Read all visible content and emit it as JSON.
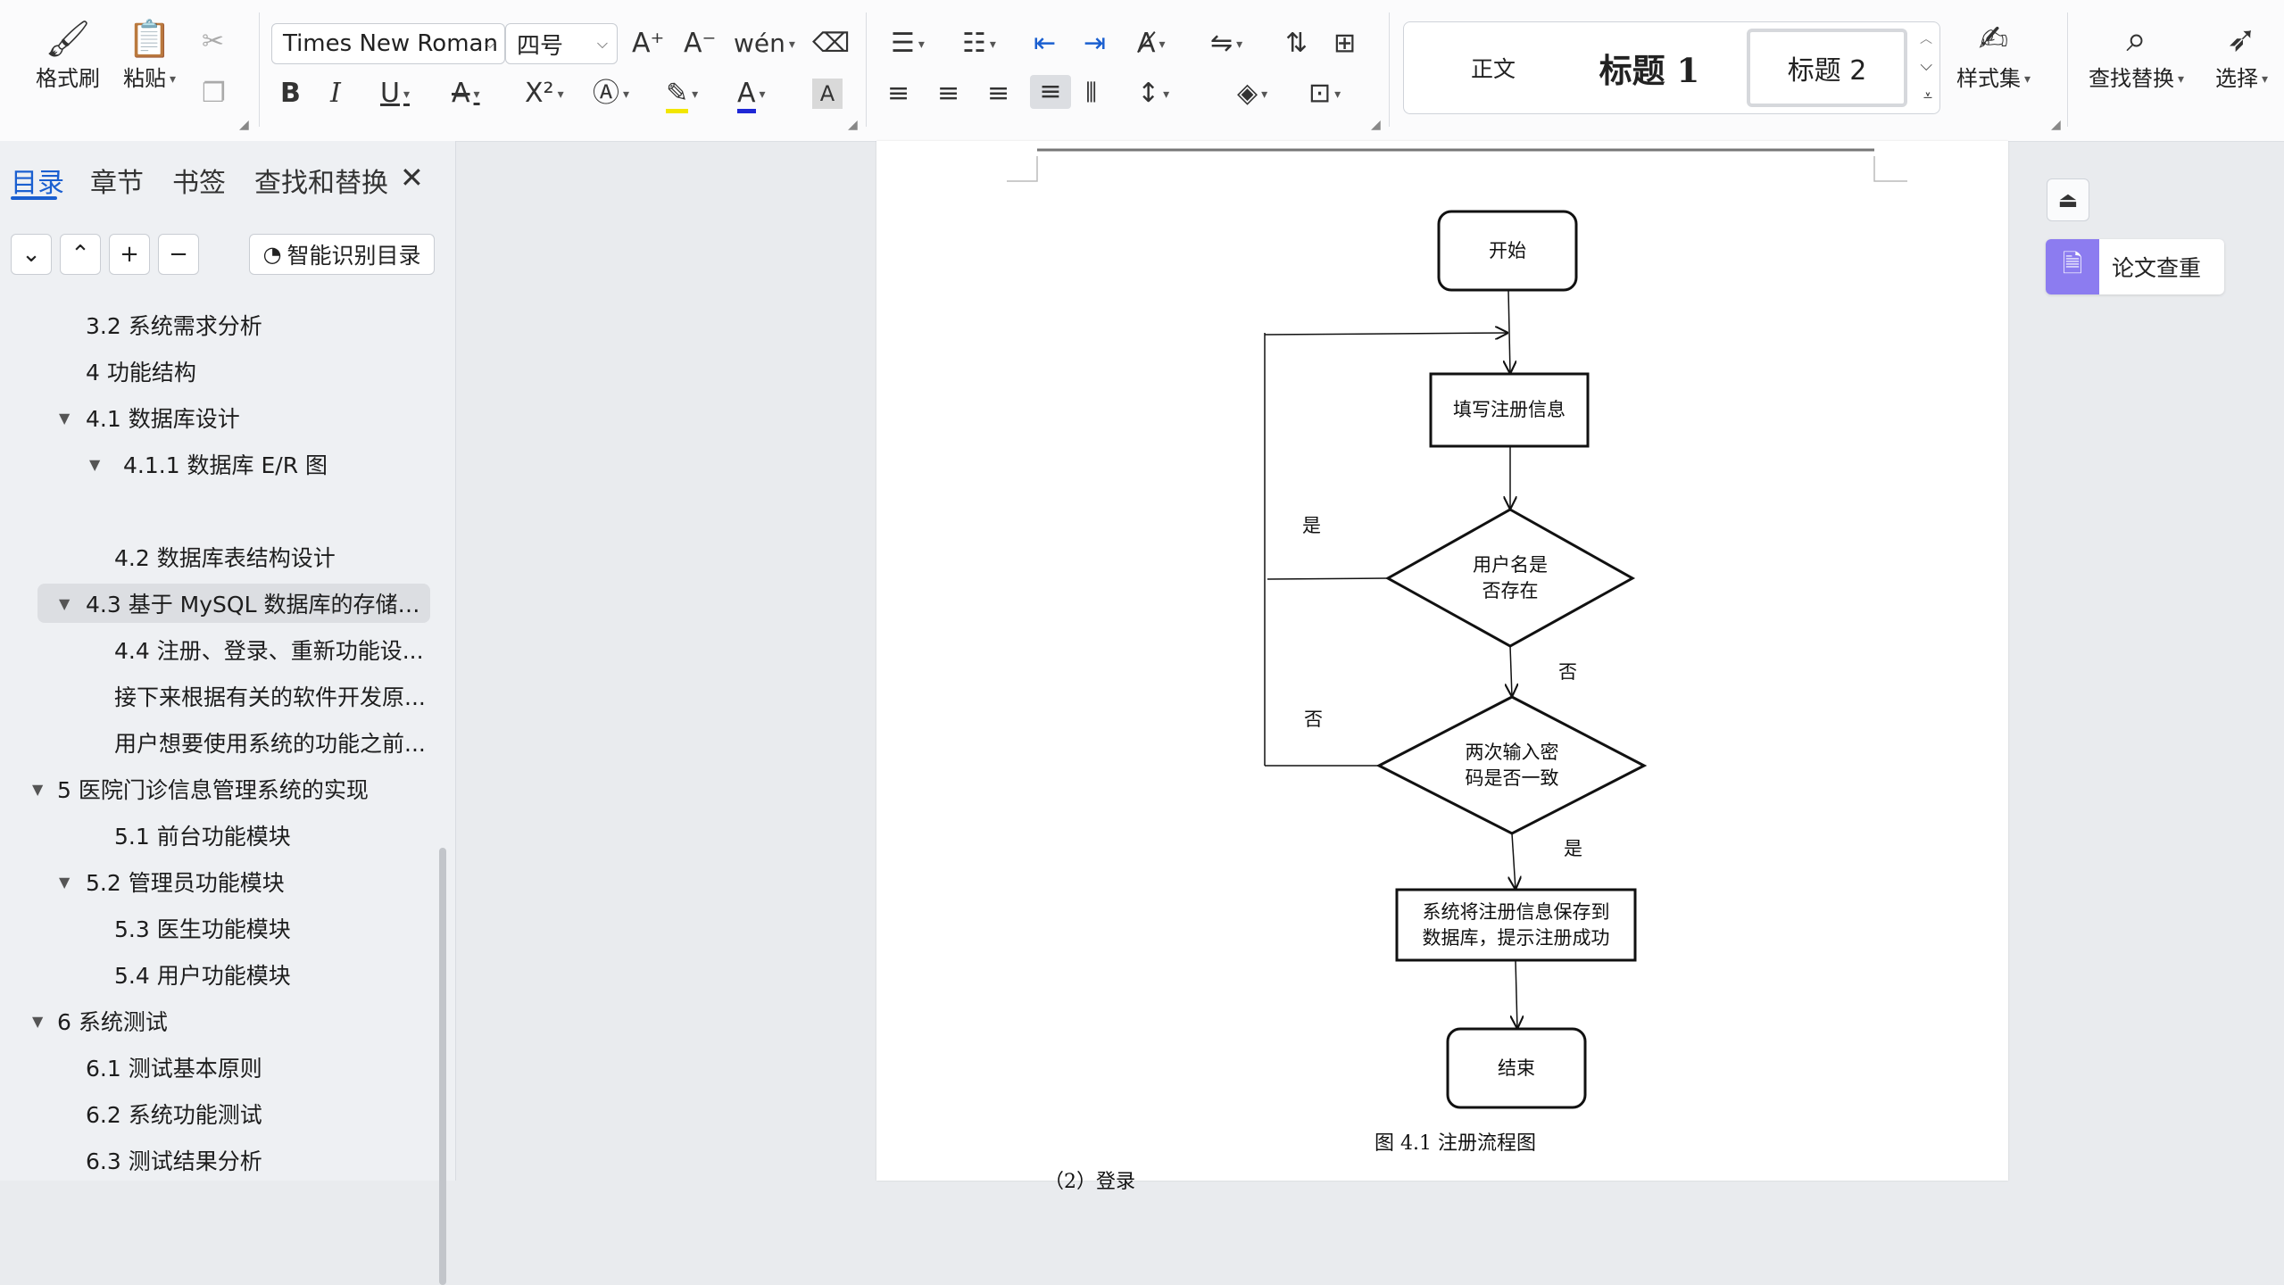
{
  "ribbon": {
    "format_painter": "格式刷",
    "paste": "粘贴",
    "font_name": "Times New Roman",
    "font_size": "四号",
    "style_set": "样式集",
    "find_replace": "查找替换",
    "select": "选择",
    "styles": {
      "normal": "正文",
      "heading1": "标题 1",
      "heading2": "标题 2"
    }
  },
  "nav": {
    "tabs": [
      "目录",
      "章节",
      "书签",
      "查找和替换"
    ],
    "smart_toc": "智能识别目录",
    "toc": [
      {
        "label": "3.2  系统需求分析"
      },
      {
        "label": "4 功能结构"
      },
      {
        "label": "4.1  数据库设计"
      },
      {
        "label": "4.1.1  数据库 E/R 图"
      },
      {
        "label": "4.2  数据库表结构设计"
      },
      {
        "label": "4.3  基于 MySQL 数据库的存储设..."
      },
      {
        "label": "4.4  注册、登录、重新功能设..."
      },
      {
        "label": "接下来根据有关的软件开发原..."
      },
      {
        "label": "用户想要使用系统的功能之前..."
      },
      {
        "label": "5  医院门诊信息管理系统的实现"
      },
      {
        "label": "5.1  前台功能模块"
      },
      {
        "label": "5.2 管理员功能模块"
      },
      {
        "label": "5.3  医生功能模块"
      },
      {
        "label": "5.4  用户功能模块"
      },
      {
        "label": "6  系统测试"
      },
      {
        "label": "6.1  测试基本原则"
      },
      {
        "label": "6.2  系统功能测试"
      },
      {
        "label": "6.3  测试结果分析"
      }
    ]
  },
  "flowchart": {
    "start": "开始",
    "fill_info": "填写注册信息",
    "username_exists_l1": "用户名是",
    "username_exists_l2": "否存在",
    "pwd_match_l1": "两次输入密",
    "pwd_match_l2": "码是否一致",
    "save_l1": "系统将注册信息保存到",
    "save_l2": "数据库，提示注册成功",
    "end": "结束",
    "yes": "是",
    "no": "否"
  },
  "document": {
    "caption": "图 4.1  注册流程图",
    "next_paragraph": "（2）登录"
  },
  "side_panel": {
    "plagiarism_check": "论文查重"
  }
}
